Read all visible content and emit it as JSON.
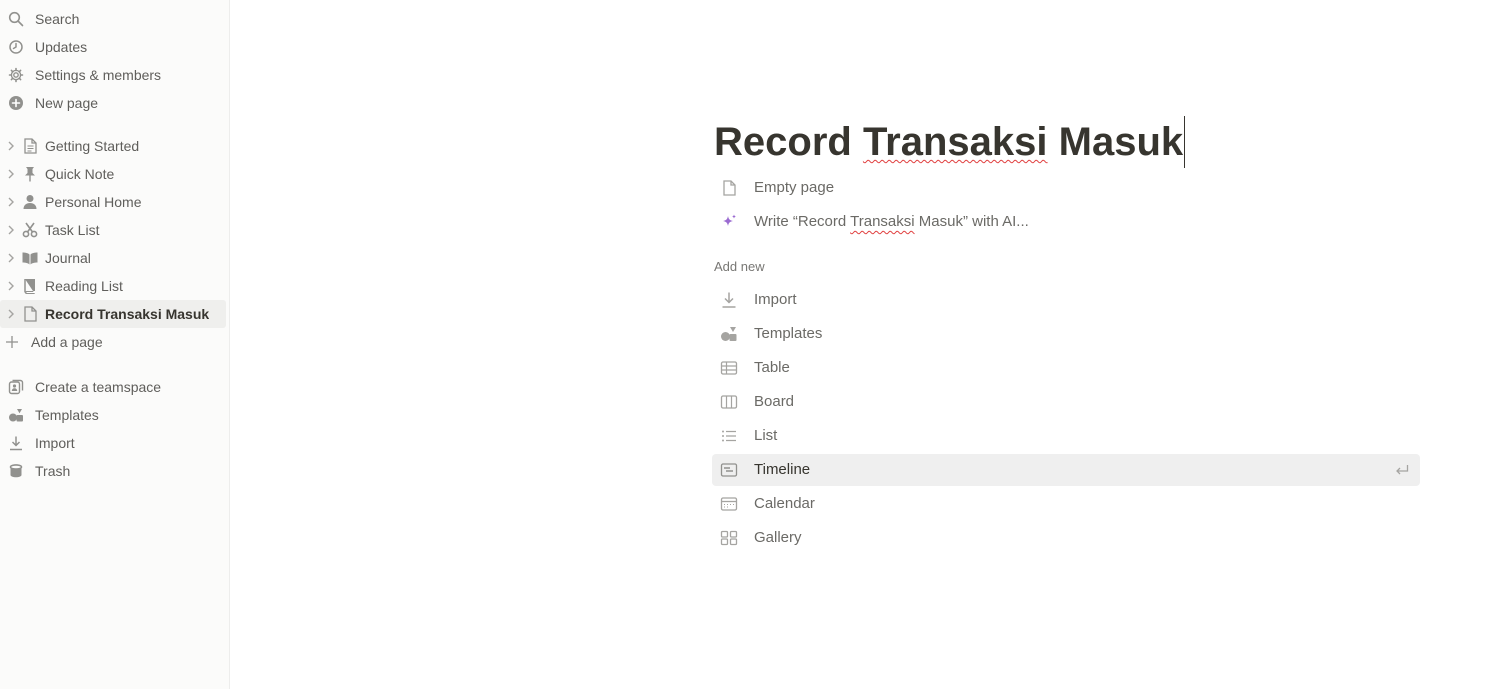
{
  "sidebar": {
    "top": [
      {
        "label": "Search",
        "icon": "search-icon"
      },
      {
        "label": "Updates",
        "icon": "clock-icon"
      },
      {
        "label": "Settings & members",
        "icon": "gear-icon"
      },
      {
        "label": "New page",
        "icon": "plus-circle-icon"
      }
    ],
    "pages": [
      {
        "label": "Getting Started",
        "icon": "page-icon"
      },
      {
        "label": "Quick Note",
        "icon": "pin-icon"
      },
      {
        "label": "Personal Home",
        "icon": "person-icon"
      },
      {
        "label": "Task List",
        "icon": "scissors-icon"
      },
      {
        "label": "Journal",
        "icon": "book-open-icon"
      },
      {
        "label": "Reading List",
        "icon": "book-icon"
      },
      {
        "label": "Record Transaksi Masuk",
        "icon": "page-icon"
      }
    ],
    "add_page": "Add a page",
    "bottom": [
      {
        "label": "Create a teamspace",
        "icon": "teamspace-icon"
      },
      {
        "label": "Templates",
        "icon": "shapes-icon"
      },
      {
        "label": "Import",
        "icon": "download-icon"
      },
      {
        "label": "Trash",
        "icon": "trash-icon"
      }
    ]
  },
  "page": {
    "title_prefix": "Record ",
    "title_squiggle": "Transaksi",
    "title_suffix": " Masuk",
    "options": [
      {
        "label": "Empty page",
        "icon": "page-icon"
      }
    ],
    "ai_prefix": "Write “Record ",
    "ai_squiggle": "Transaksi",
    "ai_suffix": " Masuk” with AI...",
    "add_new_label": "Add new",
    "add_new": [
      {
        "label": "Import",
        "icon": "download-icon"
      },
      {
        "label": "Templates",
        "icon": "shapes-icon"
      },
      {
        "label": "Table",
        "icon": "table-icon"
      },
      {
        "label": "Board",
        "icon": "board-icon"
      },
      {
        "label": "List",
        "icon": "list-icon"
      },
      {
        "label": "Timeline",
        "icon": "timeline-icon"
      },
      {
        "label": "Calendar",
        "icon": "calendar-icon"
      },
      {
        "label": "Gallery",
        "icon": "gallery-icon"
      }
    ],
    "highlighted": "Timeline"
  },
  "colors": {
    "sidebar_bg": "#fbfbfa",
    "text": "#37352f",
    "muted": "#787774",
    "ai_accent": "#9b6bd1",
    "hover": "#efefef"
  }
}
